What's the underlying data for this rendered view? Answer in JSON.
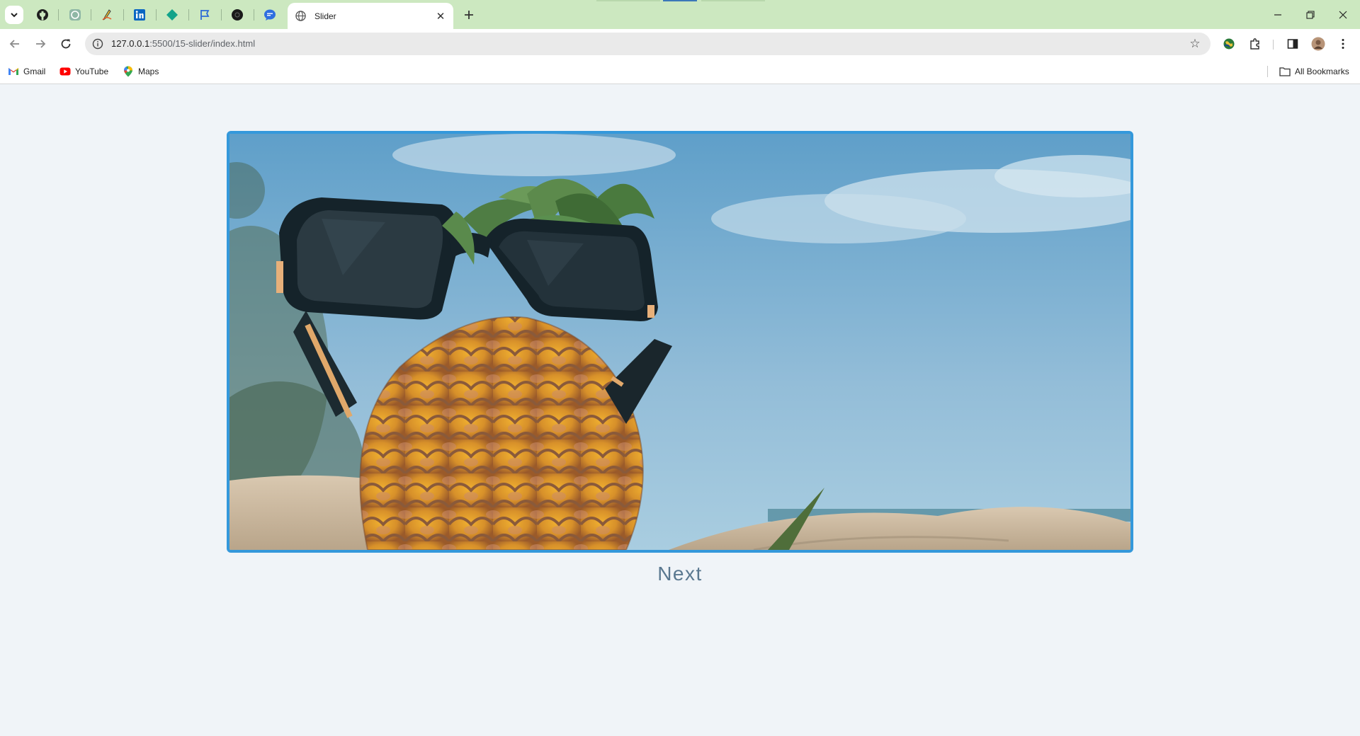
{
  "browser": {
    "active_tab_title": "Slider",
    "url_host": "127.0.0.1",
    "url_path": ":5500/15-slider/index.html",
    "accent": "#3498db",
    "tab_strip_color": "#cce8c0"
  },
  "pinned_tabs": [
    {
      "icon": "github-icon"
    },
    {
      "icon": "chatgpt-icon"
    },
    {
      "icon": "pencil-icon"
    },
    {
      "icon": "linkedin-icon"
    },
    {
      "icon": "diamond-icon"
    },
    {
      "icon": "flag-icon"
    },
    {
      "icon": "dark-circle-icon"
    },
    {
      "icon": "chat-bubble-icon"
    }
  ],
  "bookmarks": {
    "items": [
      {
        "label": "Gmail",
        "icon": "gmail-icon"
      },
      {
        "label": "YouTube",
        "icon": "youtube-icon"
      },
      {
        "label": "Maps",
        "icon": "maps-icon"
      }
    ],
    "all_bookmarks_label": "All Bookmarks"
  },
  "slider": {
    "image_subject": "pineapple wearing sunglasses on beach",
    "next_label": "Next"
  }
}
